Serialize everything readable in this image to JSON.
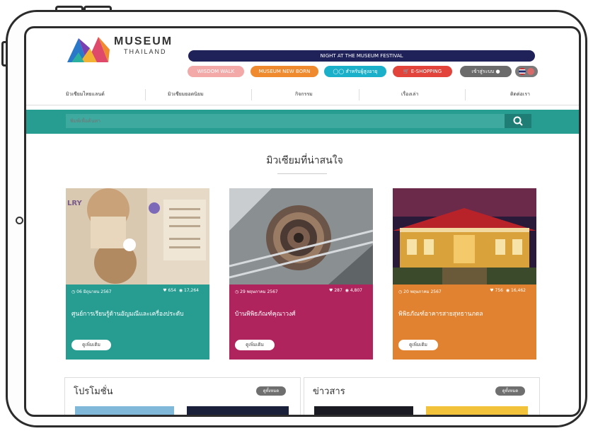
{
  "brand": {
    "name": "MUSEUM",
    "sub": "THAILAND"
  },
  "banner": {
    "festival": "NIGHT AT THE MUSEUM FESTIVAL"
  },
  "top_links": [
    {
      "label": "WISDOM WALK",
      "color": "#f3a9a8"
    },
    {
      "label": "MUSEUM NEW BORN",
      "color": "#f08a2e"
    },
    {
      "label": "สำหรับผู้สูงอายุ",
      "color": "#1bb0c9"
    },
    {
      "label": "E-SHOPPING",
      "color": "#e2443c"
    }
  ],
  "login": {
    "label": "เข้าสู่ระบบ"
  },
  "nav": [
    "มิวเซียมไทยแลนด์",
    "มิวเซียมยอดนิยม",
    "กิจกรรม",
    "เรื่องเล่า",
    "ติดต่อเรา"
  ],
  "search": {
    "placeholder": "พิมพ์เพื่อค้นหา"
  },
  "section": {
    "title": "มิวเซียมที่น่าสนใจ"
  },
  "cards": [
    {
      "date": "06 มิถุนายน 2567",
      "likes": "654",
      "views": "17,264",
      "name": "ศูนย์การเรียนรู้ด้านอัญมณีและเครื่องประดับ",
      "more": "ดูเพิ่มเติม",
      "color": "#279d92",
      "img_text": "LRY"
    },
    {
      "date": "29 พฤษภาคม 2567",
      "likes": "287",
      "views": "4,807",
      "name": "บ้านพิพิธภัณฑ์คุณาวงศ์",
      "more": "ดูเพิ่มเติม",
      "color": "#b0245e"
    },
    {
      "date": "20 พฤษภาคม 2567",
      "likes": "756",
      "views": "16,462",
      "name": "พิพิธภัณฑ์อาคารสายสุทธานภดล",
      "more": "ดูเพิ่มเติม",
      "color": "#e0822f"
    }
  ],
  "panels": [
    {
      "title": "โปรโมชั่น",
      "all": "ดูทั้งหมด"
    },
    {
      "title": "ข่าวสาร",
      "all": "ดูทั้งหมด"
    }
  ]
}
